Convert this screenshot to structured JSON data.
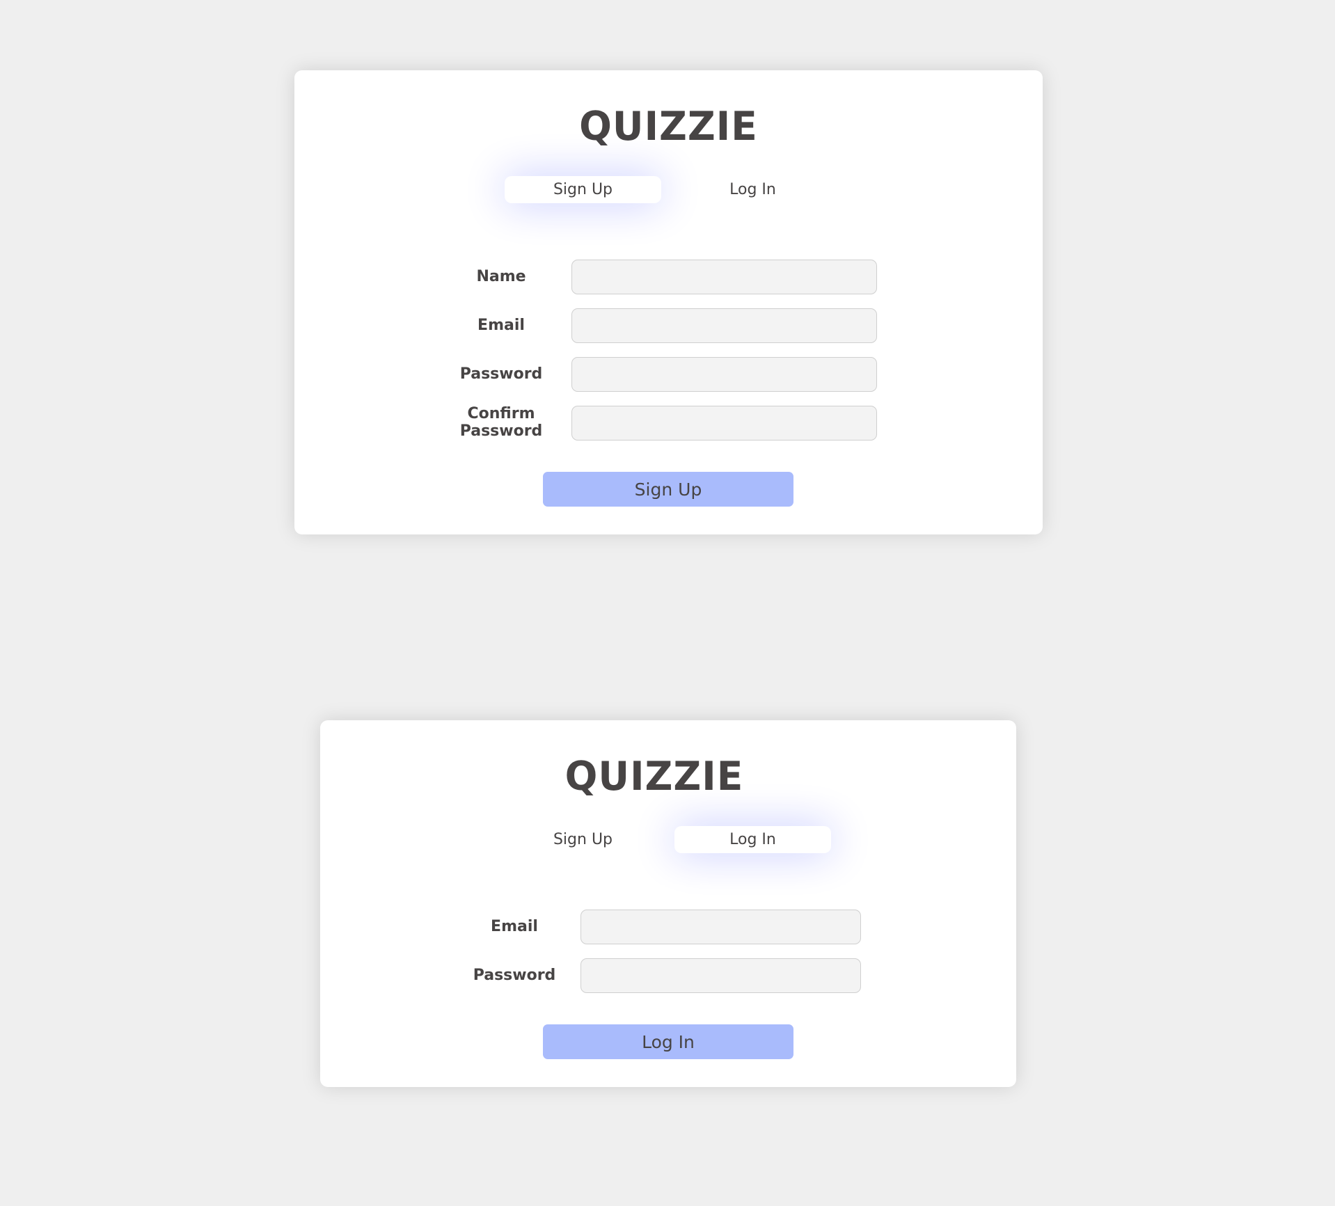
{
  "signup_card": {
    "brand": "QUIZZIE",
    "tabs": [
      {
        "label": "Sign Up",
        "active": true
      },
      {
        "label": "Log In",
        "active": false
      }
    ],
    "fields": [
      {
        "label": "Name",
        "value": "",
        "type": "text"
      },
      {
        "label": "Email",
        "value": "",
        "type": "email"
      },
      {
        "label": "Password",
        "value": "",
        "type": "password"
      },
      {
        "label": "Confirm Password",
        "value": "",
        "type": "password"
      }
    ],
    "submit_label": "Sign Up"
  },
  "login_card": {
    "brand": "QUIZZIE",
    "tabs": [
      {
        "label": "Sign Up",
        "active": false
      },
      {
        "label": "Log In",
        "active": true
      }
    ],
    "fields": [
      {
        "label": "Email",
        "value": "",
        "type": "email"
      },
      {
        "label": "Password",
        "value": "",
        "type": "password"
      }
    ],
    "submit_label": "Log In"
  },
  "colors": {
    "page_background": "#efefef",
    "card_background": "#ffffff",
    "text": "#474444",
    "button_background": "#a9bbfc",
    "input_background": "#f3f3f3",
    "active_tab_glow": "#0019ff"
  }
}
